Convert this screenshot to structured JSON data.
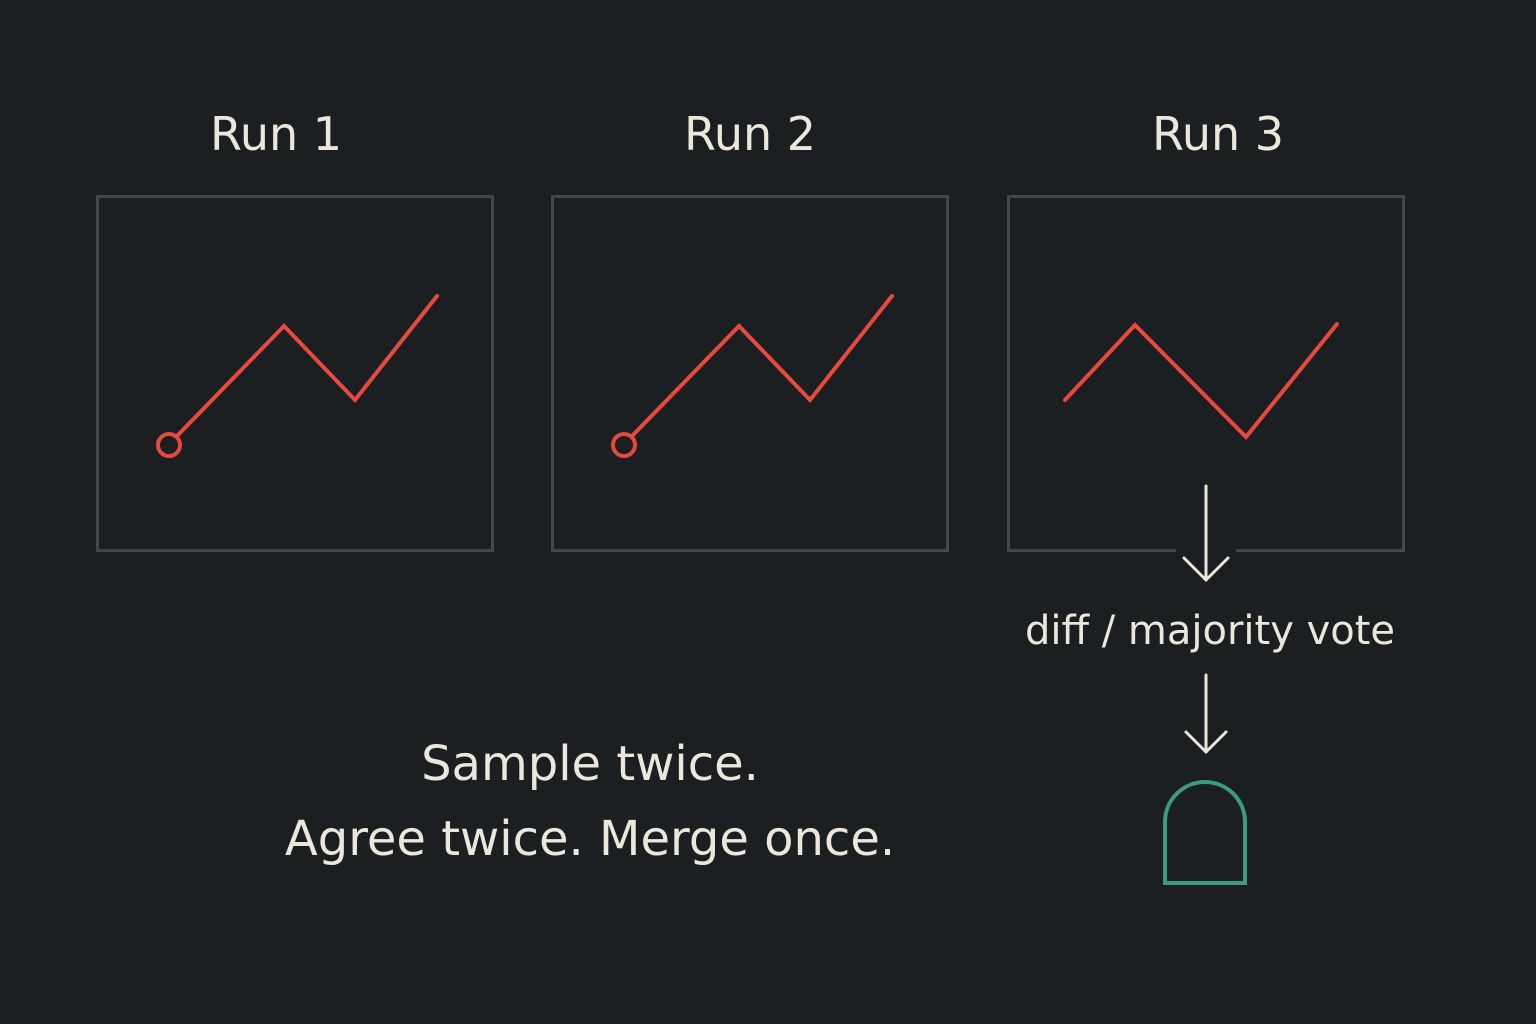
{
  "runs": [
    {
      "title": "Run 1",
      "start_marker": true
    },
    {
      "title": "Run 2",
      "start_marker": true
    },
    {
      "title": "Run 3",
      "start_marker": false
    }
  ],
  "flow": {
    "label": "diff / majority vote",
    "result_icon": "arch-gate-icon"
  },
  "motto": {
    "line1": "Sample twice.",
    "line2": "Agree twice. Merge once."
  },
  "colors": {
    "background": "#1c1f21",
    "panel_border": "#464646",
    "trace": "#e8493f",
    "text": "#ece7db",
    "result": "#3d9a7c"
  }
}
